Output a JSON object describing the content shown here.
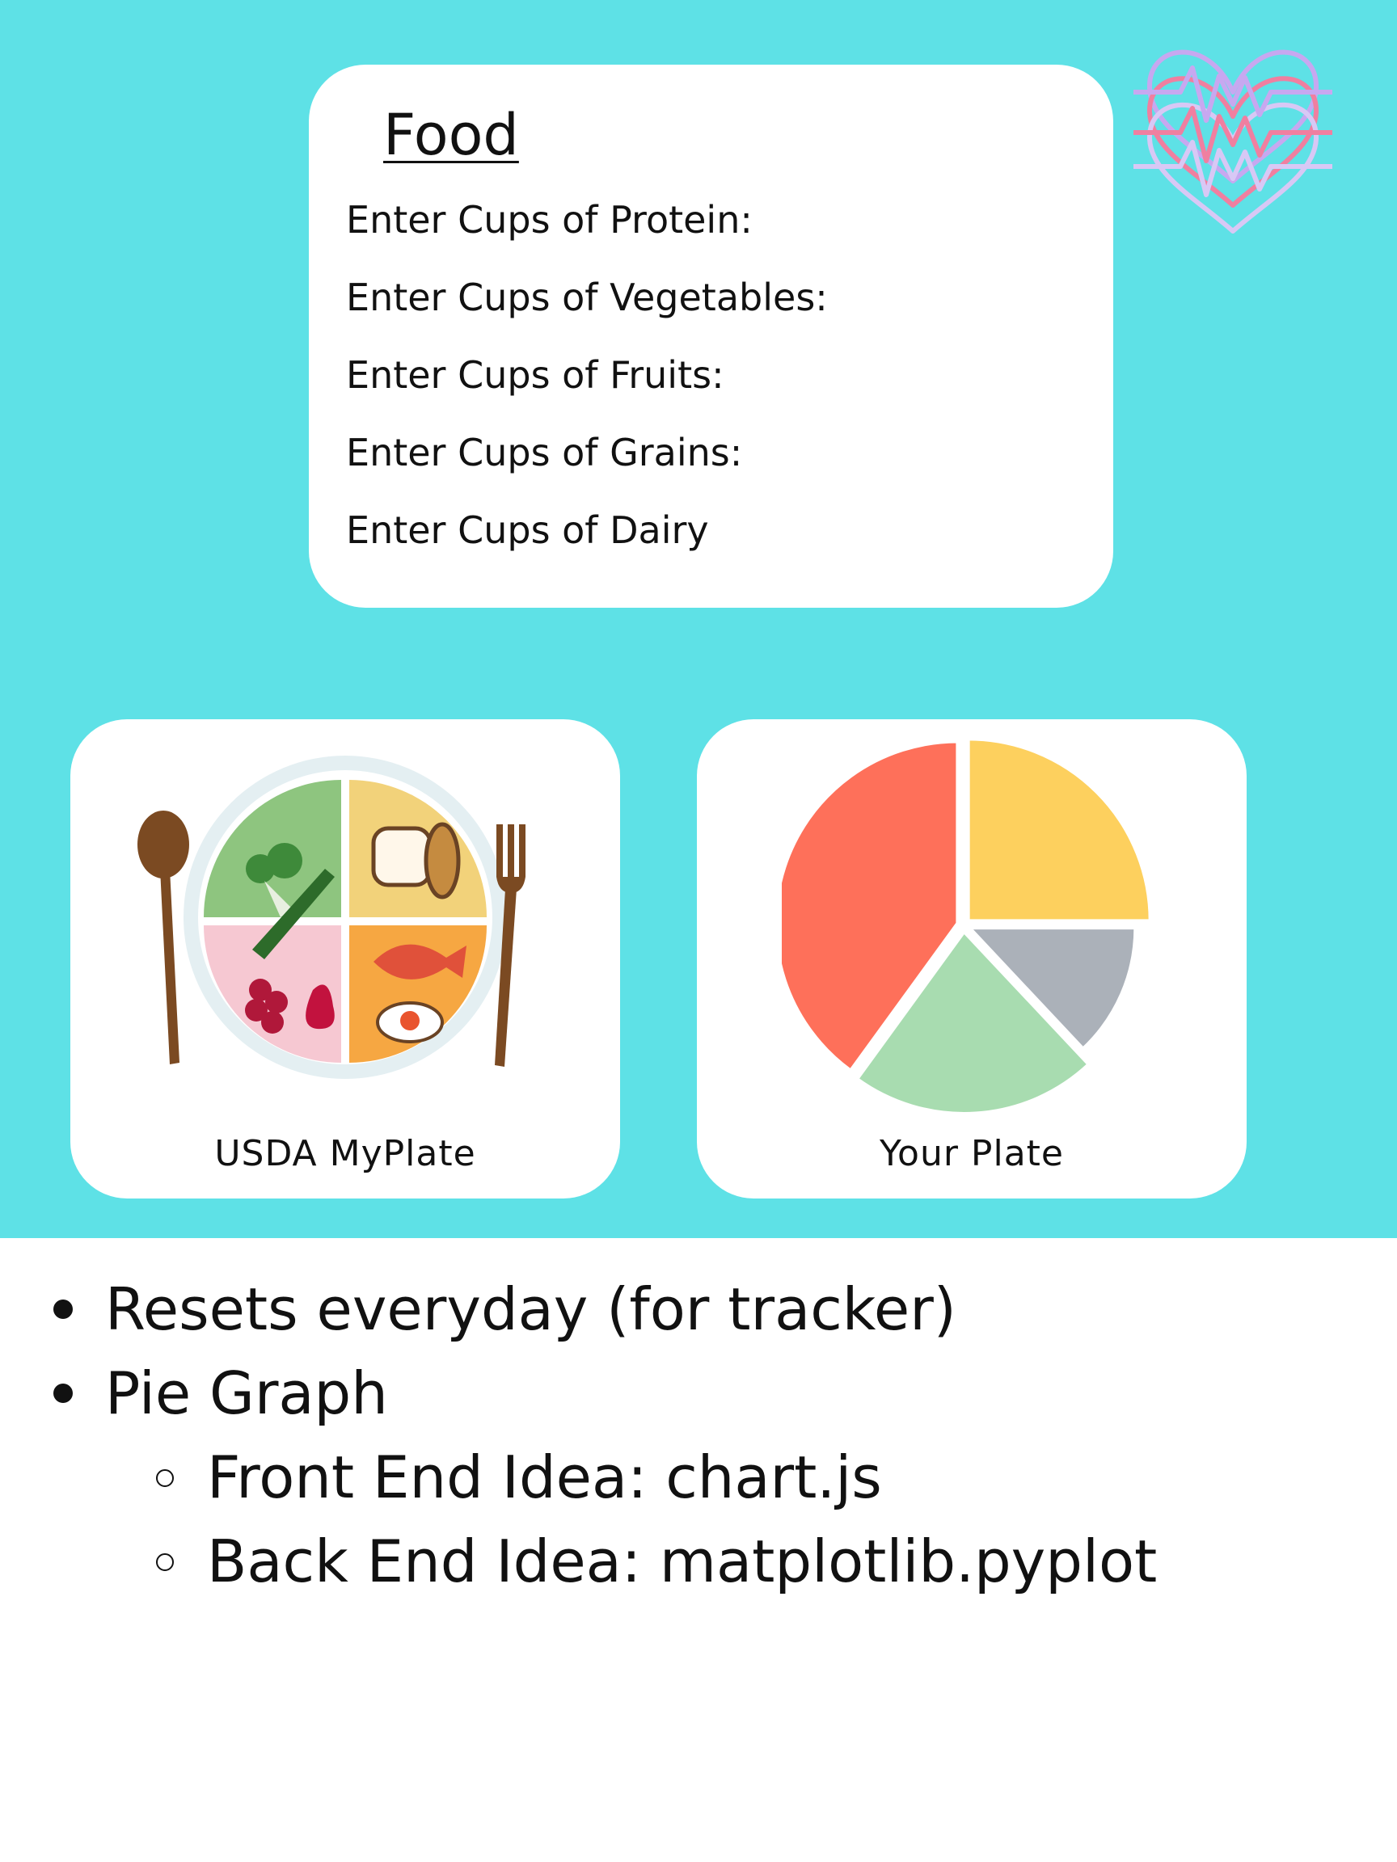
{
  "food_form": {
    "title": "Food",
    "fields": [
      {
        "label": "Enter Cups of Protein:"
      },
      {
        "label": "Enter Cups of Vegetables:"
      },
      {
        "label": "Enter Cups of Fruits:"
      },
      {
        "label": "Enter Cups of Grains:"
      },
      {
        "label": "Enter Cups of Dairy"
      }
    ]
  },
  "logo": {
    "icon": "heart-pulse-icon",
    "colors": [
      "#c7a8f0",
      "#f07fa0",
      "#d8c8f5"
    ]
  },
  "plates": {
    "usda": {
      "caption": "USDA MyPlate",
      "icon": "myplate-icon"
    },
    "yours": {
      "caption": "Your Plate"
    }
  },
  "chart_data": {
    "type": "pie",
    "values": [
      25,
      13,
      22,
      40
    ],
    "colors": [
      "#fdd05e",
      "#abb1b9",
      "#a8dcb0",
      "#fe705a"
    ],
    "title": ""
  },
  "notes": {
    "items": [
      {
        "text": "Resets everyday (for tracker)",
        "children": []
      },
      {
        "text": "Pie Graph",
        "children": [
          {
            "text": "Front End Idea: chart.js"
          },
          {
            "text": "Back End Idea: matplotlib.pyplot"
          }
        ]
      }
    ]
  },
  "colors": {
    "banner": "#5ee1e6",
    "card": "#ffffff"
  }
}
